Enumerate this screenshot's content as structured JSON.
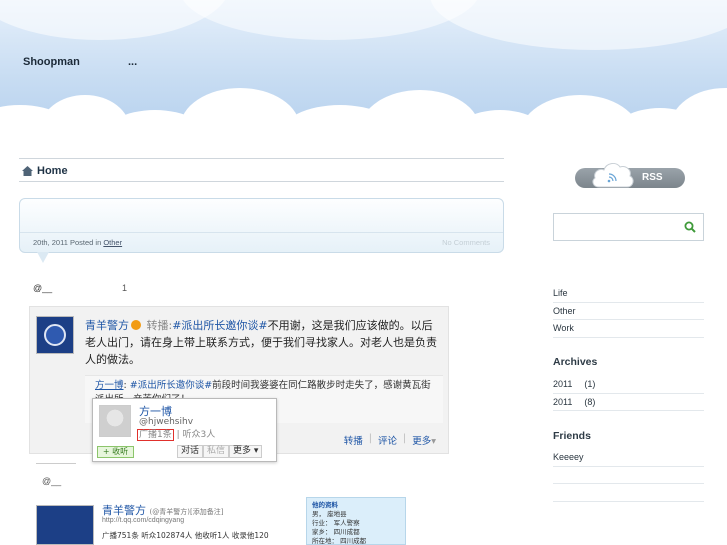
{
  "header": {
    "site_title": "Shoopman",
    "site_description": "..."
  },
  "breadcrumb": {
    "home_label": "Home"
  },
  "post": {
    "date_prefix": "20th, 2011 Posted in",
    "category": "Other",
    "comments": "No Comments",
    "line1_user": "@__",
    "line1_count": "1",
    "line2_user": "@__"
  },
  "weibo": {
    "author": "青羊警方",
    "rt_label": "转播:",
    "hashtag": "#派出所长邀你谈#",
    "text": "不用谢，这是我们应该做的。以后老人出门，请在身上带上联系方式，便于我们寻找家人。对老人也是负责人的做法。",
    "quote_author": "方一博",
    "quote_sep": ":",
    "quote_hashtag": "#派出所长邀你谈#",
    "quote_text": "前段时间我婆婆在同仁路散步时走失了，感谢黄瓦街派出所，辛苦你们了！",
    "actions": [
      "转播",
      "评论",
      "更多"
    ],
    "action_sep": "|",
    "more_arrow": "▾"
  },
  "popup": {
    "name": "方一博",
    "handle": "@hjwehsihv",
    "broadcast": "广播1条",
    "listeners": "| 听众3人",
    "follow_label": "+ 收听",
    "buttons": [
      "对话",
      "私信",
      "更多 ▾"
    ]
  },
  "profile2": {
    "name": "青羊警方",
    "name_note": "(@青羊警方)[添加备注]",
    "url": "http://t.qq.com/cdqingyang",
    "stats": "广播751条  听众102874人  他收听1人  收录他120"
  },
  "infobox": {
    "heading": "他的资料",
    "lines": [
      "男，  座地县",
      "行业：  军人警察",
      "家乡：  四川成都",
      "所在地：  四川成都"
    ]
  },
  "sidebar": {
    "rss_label": "RSS",
    "search_placeholder": "",
    "categories": [
      "Life",
      "Other",
      "Work"
    ],
    "archives_heading": "Archives",
    "archives": [
      {
        "label": "2011",
        "count": "(1)"
      },
      {
        "label": "2011",
        "count": "(8)"
      }
    ],
    "friends_heading": "Friends",
    "friends": [
      "Keeeey",
      "",
      ""
    ]
  },
  "colors": {
    "link": "#1f56a6",
    "sky_top": "#e6f0fb",
    "sky_bottom": "#b3cfee",
    "rss_gray": "#8a939a"
  }
}
